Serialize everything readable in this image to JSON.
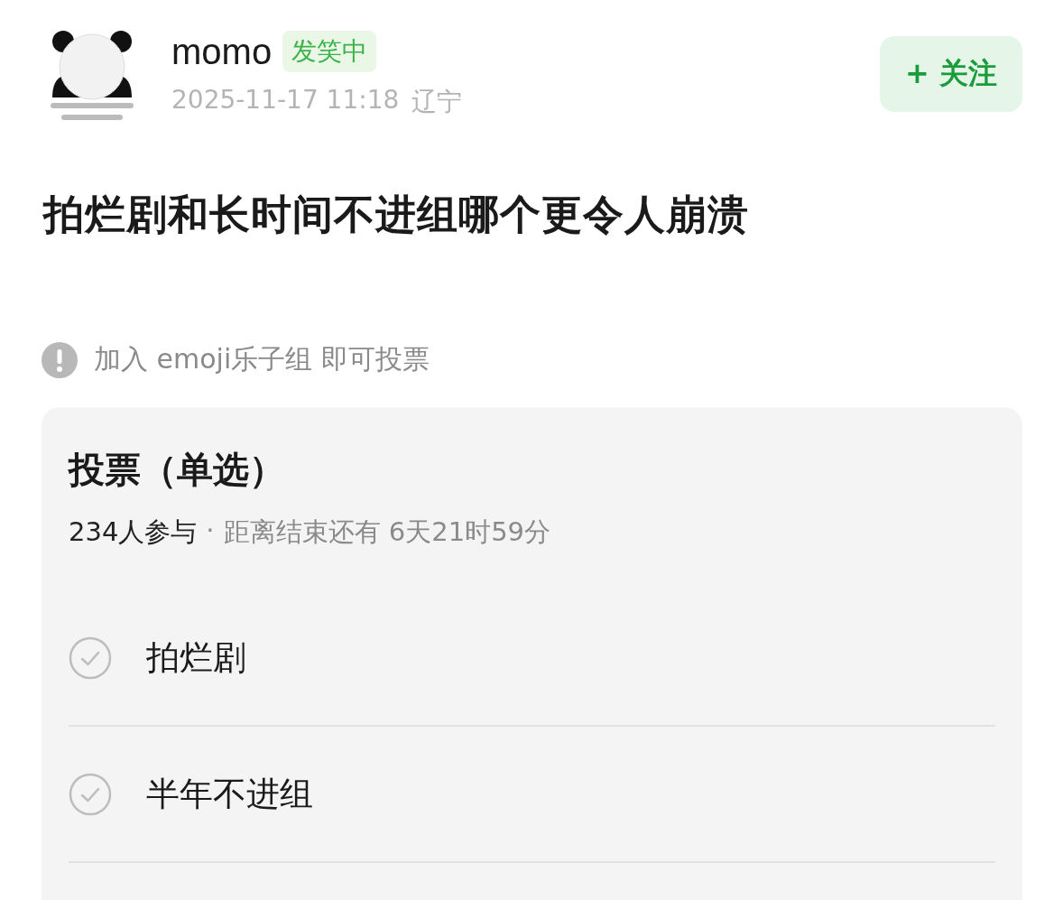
{
  "author": {
    "name": "momo",
    "badge": "发笑中",
    "time": "2025-11-17 11:18",
    "location": "辽宁"
  },
  "follow_button": {
    "label": "+ 关注",
    "followed": false
  },
  "post": {
    "title": "拍烂剧和长时间不进组哪个更令人崩溃"
  },
  "notice": "加入 emoji乐子组 即可投票",
  "poll": {
    "title": "投票（单选）",
    "participants": "234人参与",
    "separator": "·",
    "remaining": "距离结束还有 6天21时59分",
    "options": [
      {
        "label": "拍烂剧",
        "selected": false
      },
      {
        "label": "半年不进组",
        "selected": false
      }
    ]
  }
}
